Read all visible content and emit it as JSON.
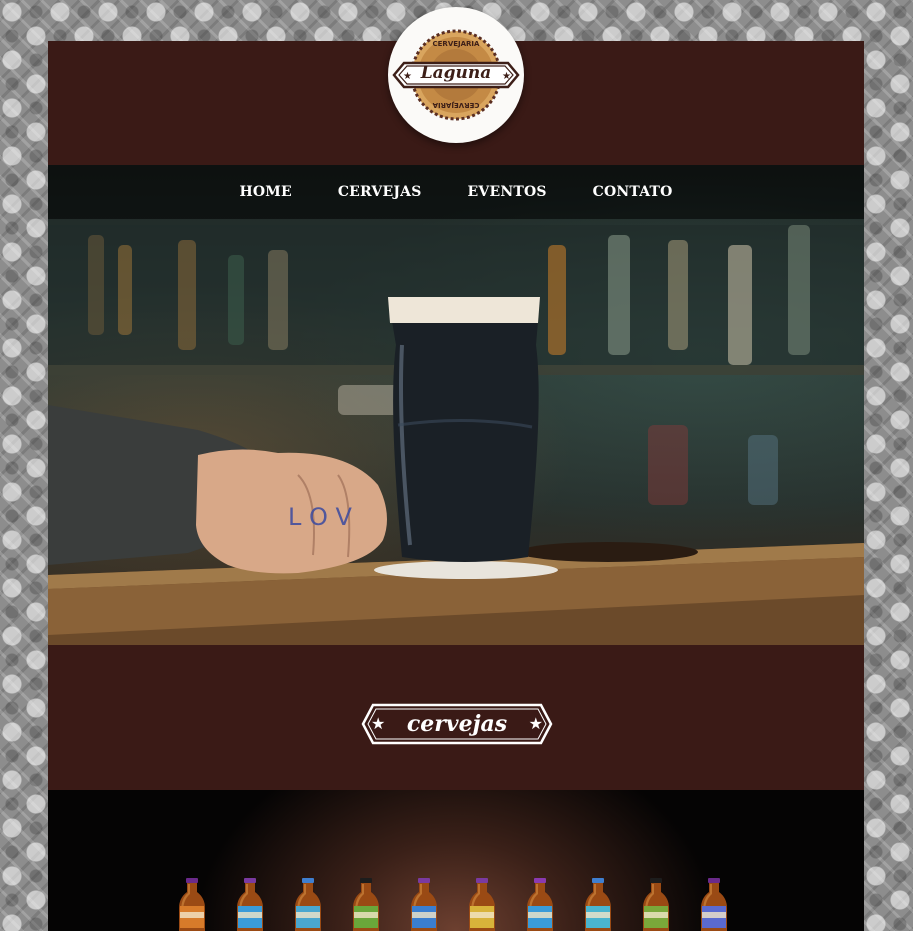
{
  "logo": {
    "top_text": "CERVEJARIA",
    "name": "Laguna",
    "bottom_text": "CERVEJARIA"
  },
  "nav": {
    "items": [
      "HOME",
      "CERVEJAS",
      "EVENTOS",
      "CONTATO"
    ]
  },
  "section": {
    "title": "cervejas"
  },
  "colors": {
    "brand_brown": "#3a1a16",
    "logo_bg": "#fbfaf8",
    "bottle_caps": [
      "#6a2a8a",
      "#7a3aa0",
      "#3f7fd0",
      "#1d1d1d",
      "#7a3aa0",
      "#7a3aa0",
      "#8a3ab0",
      "#3f7fd0",
      "#1d1d1d",
      "#6a2a8a"
    ],
    "bottle_labels": [
      "#d77b2a",
      "#3a9bd8",
      "#4aa7cf",
      "#6aa73a",
      "#3a7ed0",
      "#d8b33a",
      "#3a9bd8",
      "#4ab5cf",
      "#7aa83a",
      "#5a6ad0"
    ]
  },
  "icons": [
    "star-icon",
    "star-icon",
    "cervejaria-logo"
  ]
}
